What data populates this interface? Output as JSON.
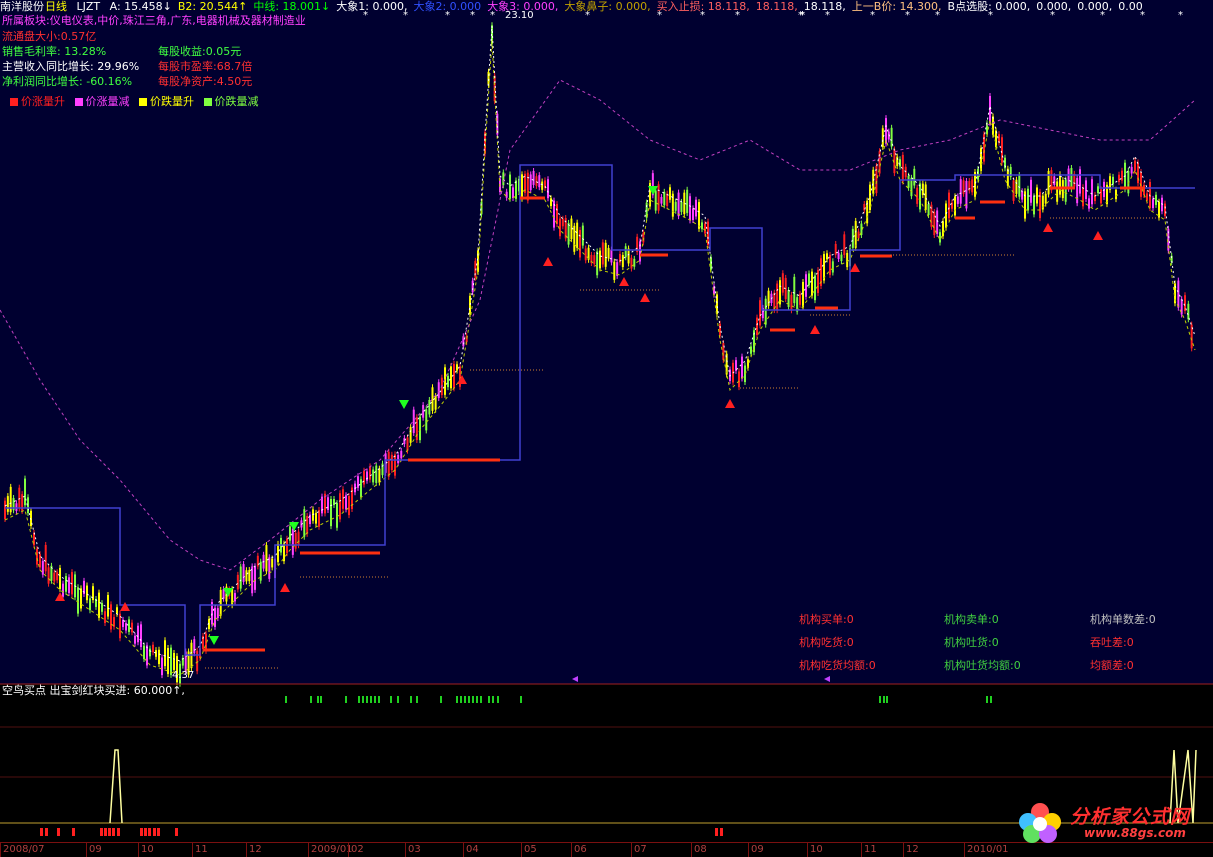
{
  "header": {
    "stock": "南洋股份",
    "period": "日线",
    "indicator": "LJZT",
    "items": [
      {
        "label": "A:",
        "value": "15.458",
        "arrow": "↓",
        "color": "#ffffff"
      },
      {
        "label": "B2:",
        "value": "20.544",
        "arrow": "↑",
        "color": "#ffff00"
      },
      {
        "label": "中线:",
        "value": "18.001",
        "arrow": "↓",
        "color": "#00ff00"
      },
      {
        "label": "大象1:",
        "value": "0.000,",
        "arrow": "",
        "color": "#ffffff"
      },
      {
        "label": "大象2:",
        "value": "0.000",
        "arrow": "",
        "color": "#3050ff"
      },
      {
        "label": "大象3:",
        "value": "0.000,",
        "arrow": "",
        "color": "#ff40ff"
      },
      {
        "label": "大象鼻子:",
        "value": "0.000,",
        "arrow": "",
        "color": "#c0a000"
      },
      {
        "label": "买入止损:",
        "value": "18.118,",
        "arrow": "",
        "color": "#ff6060"
      },
      {
        "label": "",
        "value": "18.118,",
        "arrow": "",
        "color": "#ff6060"
      },
      {
        "label": "",
        "value": "18.118,",
        "arrow": "",
        "color": "#ffffff"
      },
      {
        "label": "上一B价:",
        "value": "14.300,",
        "arrow": "",
        "color": "#ffc080"
      },
      {
        "label": "B点选股:",
        "value": "0.000,",
        "arrow": "",
        "color": "#ffffff"
      },
      {
        "label": "",
        "value": "0.000,",
        "arrow": "",
        "color": "#ffffff"
      },
      {
        "label": "",
        "value": "0.000,",
        "arrow": "",
        "color": "#ffffff"
      },
      {
        "label": "",
        "value": "0.00",
        "arrow": "",
        "color": "#ffffff"
      }
    ]
  },
  "info": {
    "sector_label": "所属板块:",
    "sector_value": "仪电仪表,中价,珠江三角,广东,电器机械及器材制造业",
    "float_label": "流通盘大小:",
    "float_value": "0.57亿",
    "margin_label": "销售毛利率:",
    "margin_value": "13.28%",
    "eps_label": "每股收益:",
    "eps_value": "0.05元",
    "rev_label": "主营收入同比增长:",
    "rev_value": "29.96%",
    "pe_label": "每股市盈率:",
    "pe_value": "68.7倍",
    "profit_label": "净利润同比增长:",
    "profit_value": "-60.16%",
    "nav_label": "每股净资产:",
    "nav_value": "4.50元"
  },
  "legend": [
    {
      "label": "价涨量升",
      "color": "#ff2020"
    },
    {
      "label": "价涨量减",
      "color": "#ff40ff"
    },
    {
      "label": "价跌量升",
      "color": "#ffff00"
    },
    {
      "label": "价跌量减",
      "color": "#80ff40"
    }
  ],
  "annotations": {
    "high": "23.10",
    "low": "4.37"
  },
  "institution": {
    "buy": "机构买单:0",
    "sell": "机构卖单:0",
    "diff": "机构单数差:0",
    "eat": "机构吃货:0",
    "spit": "机构吐货:0",
    "eatspit_diff": "吞吐差:0",
    "eat_avg": "机构吃货均额:0",
    "spit_avg": "机构吐货均额:0",
    "avg_diff": "均额差:0"
  },
  "sub_header": "空鸟买点 出宝剑红块买进: 60.000↑,",
  "date_ticks": [
    "2008/07",
    "09",
    "10",
    "11",
    "12",
    "2009/01",
    "02",
    "03",
    "04",
    "05",
    "06",
    "07",
    "08",
    "09",
    "10",
    "11",
    "12",
    "2010/01"
  ],
  "logo": {
    "title": "分析家公式网",
    "url": "www.88gs.com"
  },
  "colors": {
    "background": "#000030",
    "up_red": "#ff2020",
    "up_magenta": "#ff40ff",
    "down_yellow": "#ffff00",
    "down_green": "#80ff40"
  }
}
